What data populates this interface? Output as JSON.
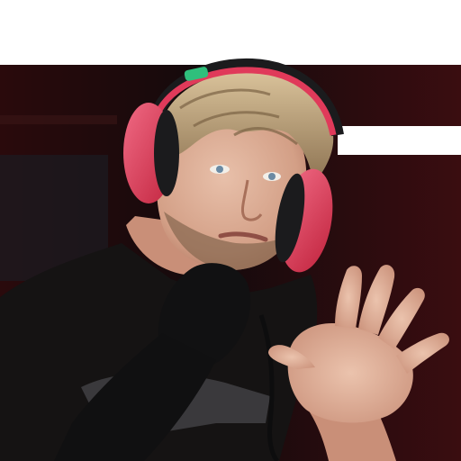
{
  "image": {
    "subject": "streamer-with-headphones-waving",
    "colors": {
      "background_outer": "#ffffff",
      "background_dark": "#1a0e0f",
      "background_red": "#3a0d10",
      "skin": "#e0b09a",
      "skin_shadow": "#b97f68",
      "hair": "#b9a07c",
      "hair_dark": "#6e5a3f",
      "headphones": "#e03a5a",
      "headphones_dark": "#1b1b1d",
      "headphones_accent": "#2fbf7c",
      "shirt": "#151313",
      "mic": "#111112",
      "shirt_print": "#5a5a5e"
    },
    "icons": [
      "headphones-icon",
      "microphone-icon"
    ]
  }
}
